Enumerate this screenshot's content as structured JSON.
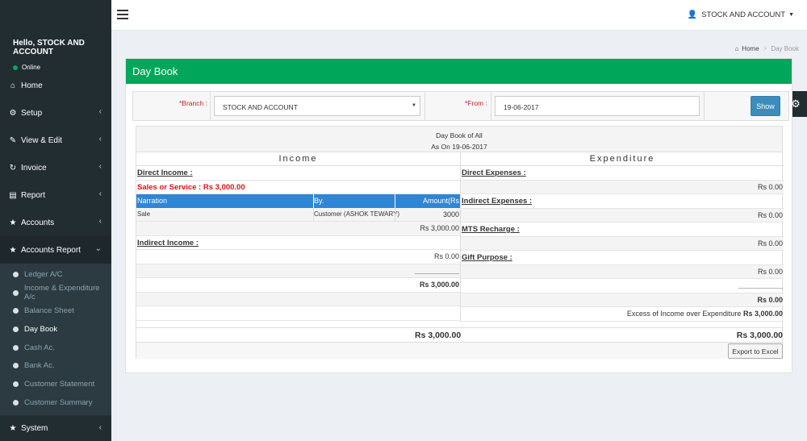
{
  "sidebar": {
    "greeting": "Hello, STOCK AND ACCOUNT",
    "status": "Online",
    "menu": [
      {
        "label": "Home",
        "icon": "home-icon"
      },
      {
        "label": "Setup",
        "icon": "cogs-icon"
      },
      {
        "label": "View & Edit",
        "icon": "edit-icon"
      },
      {
        "label": "Invoice",
        "icon": "sync-icon"
      },
      {
        "label": "Report",
        "icon": "file-icon"
      },
      {
        "label": "Accounts",
        "icon": "star-icon"
      },
      {
        "label": "Accounts Report",
        "icon": "star-icon"
      }
    ],
    "submenu": [
      "Ledger A/C",
      "Income & Expenditure A/c",
      "Balance Sheet",
      "Day Book",
      "Cash Ac.",
      "Bank Ac.",
      "Customer Statement",
      "Customer Summary"
    ],
    "last": {
      "label": "System",
      "icon": "star-icon"
    }
  },
  "header": {
    "user": "STOCK AND ACCOUNT"
  },
  "breadcrumb": {
    "home": "Home",
    "current": "Day Book"
  },
  "page": {
    "title": "Day Book",
    "branch_label": "*Branch :",
    "branch_value": "STOCK AND ACCOUNT",
    "from_label": "*From :",
    "from_value": "19-06-2017",
    "show_label": "Show"
  },
  "report": {
    "title1": "Day Book of All",
    "title2": "As On 19-06-2017",
    "income_title": "Income",
    "expenditure_title": "Expenditure",
    "income": {
      "direct_income": "Direct Income :",
      "sales_label": "Sales or Service :",
      "sales_value": "Rs 3,000.00",
      "table_headers": [
        "Narration",
        "By.",
        "Amount(Rs"
      ],
      "table_row": [
        "Sale",
        "Customer (ASHOK TEWARY)",
        "3000"
      ],
      "direct_total": "Rs 3,000.00",
      "indirect_income": "Indirect Income :",
      "indirect_total": "Rs 0.00",
      "underline": "___________",
      "subtotal": "Rs 3,000.00"
    },
    "expenditure": {
      "direct_expenses": "Direct Expenses :",
      "direct_value": "Rs 0.00",
      "indirect_expenses": "Indirect Expenses :",
      "indirect_value": "Rs 0.00",
      "mts_recharge": "MTS Recharge :",
      "mts_value": "Rs 0.00",
      "gift_purpose": "Gift Purpose :",
      "gift_value": "Rs 0.00",
      "underline": "___________",
      "subtotal": "Rs 0.00",
      "excess_label": "Excess of Income over Expenditure",
      "excess_value": "Rs 3,000.00"
    },
    "total_left": "Rs 3,000.00",
    "total_right": "Rs 3,000.00",
    "export_label": "Export to Excel"
  },
  "colors": {
    "header_green": "#00a65a",
    "sidebar_dark": "#222d32",
    "table_head_blue": "#2e86d6",
    "required_red": "#c92222",
    "sales_red": "#dd1111"
  }
}
